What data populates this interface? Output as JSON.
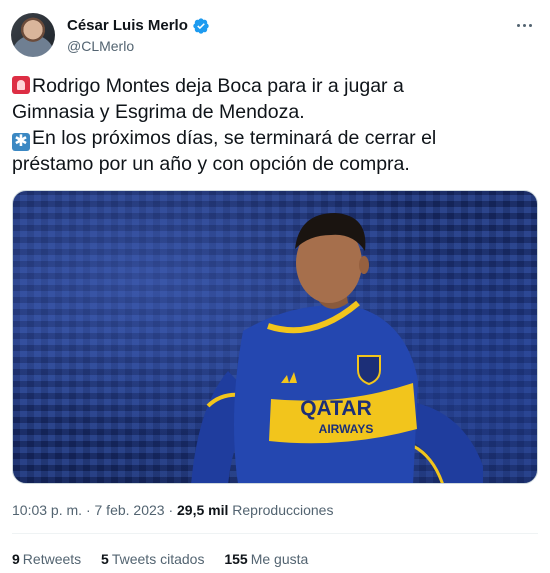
{
  "author": {
    "display_name": "César Luis Merlo",
    "handle": "@CLMerlo",
    "verified": true
  },
  "tweet": {
    "lines": [
      "Rodrigo Montes deja Boca para ir a jugar a",
      "Gimnasia y Esgrima de Mendoza.",
      "En los próximos días, se terminará de cerrar el",
      "préstamo por un año y con opción de compra."
    ],
    "emojis": [
      "siren-icon",
      "asterisk-icon"
    ],
    "asterisk_glyph": "✱"
  },
  "media": {
    "shirt_sponsor_top": "QATAR",
    "shirt_sponsor_bottom": "AIRWAYS"
  },
  "meta": {
    "time": "10:03 p. m.",
    "separator1": "·",
    "date": "7 feb. 2023",
    "separator2": "·",
    "views_count": "29,5 mil",
    "views_label": "Reproducciones"
  },
  "stats": {
    "retweets_count": "9",
    "retweets_label": "Retweets",
    "quotes_count": "5",
    "quotes_label": "Tweets citados",
    "likes_count": "155",
    "likes_label": "Me gusta"
  },
  "colors": {
    "verified": "#1d9bf0",
    "text_primary": "#0f1419",
    "text_secondary": "#536471",
    "jersey_blue": "#1f3d9e",
    "jersey_gold": "#f2c51c"
  }
}
